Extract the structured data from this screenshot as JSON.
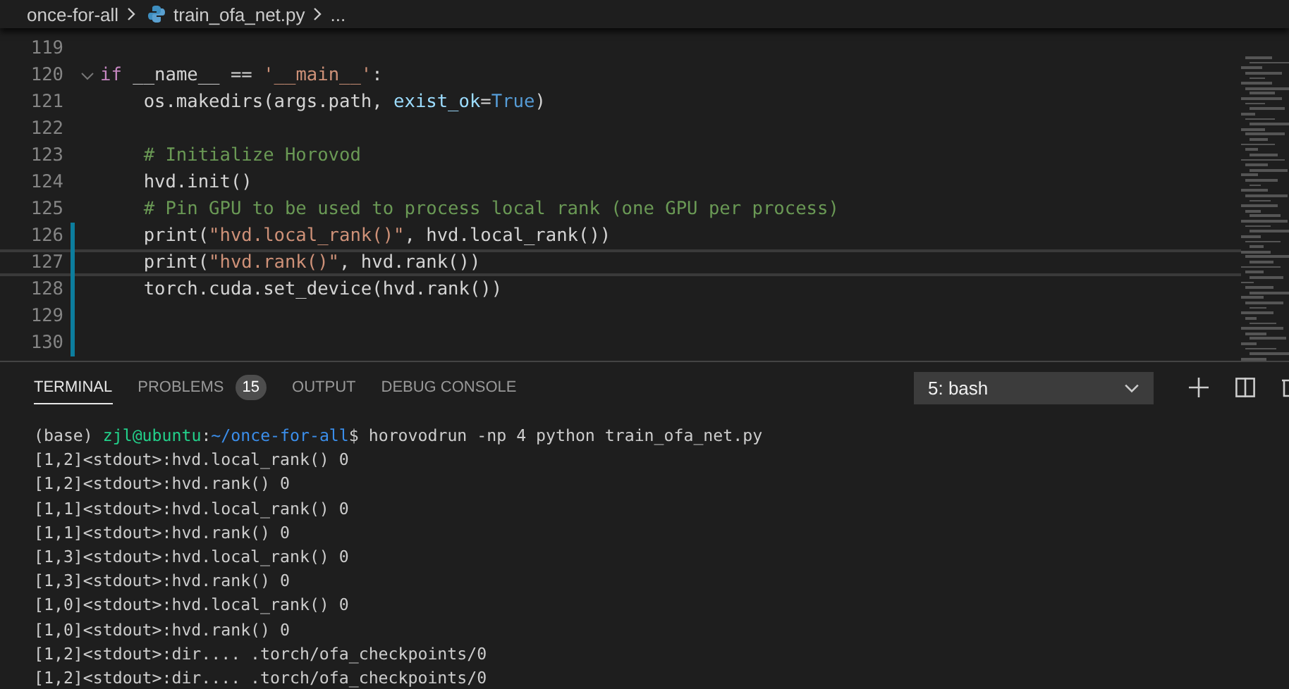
{
  "breadcrumb": {
    "folder": "once-for-all",
    "file": "train_ofa_net.py",
    "more": "..."
  },
  "editor": {
    "lines": [
      {
        "number": "119",
        "modified": false,
        "current": false,
        "foldable": false
      },
      {
        "number": "120",
        "modified": false,
        "current": false,
        "foldable": true,
        "tokens": [
          {
            "kind": "keyword",
            "text": "if"
          },
          {
            "kind": "plain",
            "text": " __name__ == "
          },
          {
            "kind": "string",
            "text": "'__main__'"
          },
          {
            "kind": "plain",
            "text": ":"
          }
        ]
      },
      {
        "number": "121",
        "modified": false,
        "current": false,
        "foldable": false,
        "tokens": [
          {
            "kind": "plain",
            "text": "    os.makedirs(args.path, "
          },
          {
            "kind": "param",
            "text": "exist_ok"
          },
          {
            "kind": "plain",
            "text": "="
          },
          {
            "kind": "constant",
            "text": "True"
          },
          {
            "kind": "plain",
            "text": ")"
          }
        ]
      },
      {
        "number": "122",
        "modified": false,
        "current": false,
        "foldable": false
      },
      {
        "number": "123",
        "modified": false,
        "current": false,
        "foldable": false,
        "tokens": [
          {
            "kind": "comment",
            "text": "    # Initialize Horovod"
          }
        ]
      },
      {
        "number": "124",
        "modified": false,
        "current": false,
        "foldable": false,
        "tokens": [
          {
            "kind": "plain",
            "text": "    hvd.init()"
          }
        ]
      },
      {
        "number": "125",
        "modified": false,
        "current": false,
        "foldable": false,
        "tokens": [
          {
            "kind": "comment",
            "text": "    # Pin GPU to be used to process local rank (one GPU per process)"
          }
        ]
      },
      {
        "number": "126",
        "modified": true,
        "current": false,
        "foldable": false,
        "tokens": [
          {
            "kind": "plain",
            "text": "    print("
          },
          {
            "kind": "string",
            "text": "\"hvd.local_rank()\""
          },
          {
            "kind": "plain",
            "text": ", hvd.local_rank())"
          }
        ]
      },
      {
        "number": "127",
        "modified": true,
        "current": true,
        "foldable": false,
        "tokens": [
          {
            "kind": "plain",
            "text": "    print("
          },
          {
            "kind": "string",
            "text": "\"hvd.rank()\""
          },
          {
            "kind": "plain",
            "text": ", hvd.rank())"
          }
        ]
      },
      {
        "number": "128",
        "modified": true,
        "current": false,
        "foldable": false,
        "tokens": [
          {
            "kind": "plain",
            "text": "    torch.cuda.set_device(hvd.rank())"
          }
        ]
      },
      {
        "number": "129",
        "modified": true,
        "current": false,
        "foldable": false
      },
      {
        "number": "130",
        "modified": true,
        "current": false,
        "foldable": false
      }
    ]
  },
  "panel": {
    "tabs": [
      {
        "label": "TERMINAL",
        "selected": true
      },
      {
        "label": "PROBLEMS",
        "selected": false,
        "badge": "15"
      },
      {
        "label": "OUTPUT",
        "selected": false
      },
      {
        "label": "DEBUG CONSOLE",
        "selected": false
      }
    ],
    "terminal_select": "5: bash",
    "terminal_lines": [
      [
        {
          "kind": "plain",
          "text": "(base) "
        },
        {
          "kind": "user",
          "text": "zjl@ubuntu"
        },
        {
          "kind": "plain",
          "text": ":"
        },
        {
          "kind": "path",
          "text": "~/once-for-all"
        },
        {
          "kind": "plain",
          "text": "$ horovodrun -np 4 python train_ofa_net.py"
        }
      ],
      [
        {
          "kind": "plain",
          "text": "[1,2]<stdout>:hvd.local_rank() 0"
        }
      ],
      [
        {
          "kind": "plain",
          "text": "[1,2]<stdout>:hvd.rank() 0"
        }
      ],
      [
        {
          "kind": "plain",
          "text": "[1,1]<stdout>:hvd.local_rank() 0"
        }
      ],
      [
        {
          "kind": "plain",
          "text": "[1,1]<stdout>:hvd.rank() 0"
        }
      ],
      [
        {
          "kind": "plain",
          "text": "[1,3]<stdout>:hvd.local_rank() 0"
        }
      ],
      [
        {
          "kind": "plain",
          "text": "[1,3]<stdout>:hvd.rank() 0"
        }
      ],
      [
        {
          "kind": "plain",
          "text": "[1,0]<stdout>:hvd.local_rank() 0"
        }
      ],
      [
        {
          "kind": "plain",
          "text": "[1,0]<stdout>:hvd.rank() 0"
        }
      ],
      [
        {
          "kind": "plain",
          "text": "[1,2]<stdout>:dir.... .torch/ofa_checkpoints/0"
        }
      ],
      [
        {
          "kind": "plain",
          "text": "[1,2]<stdout>:dir.... .torch/ofa_checkpoints/0"
        }
      ]
    ]
  }
}
